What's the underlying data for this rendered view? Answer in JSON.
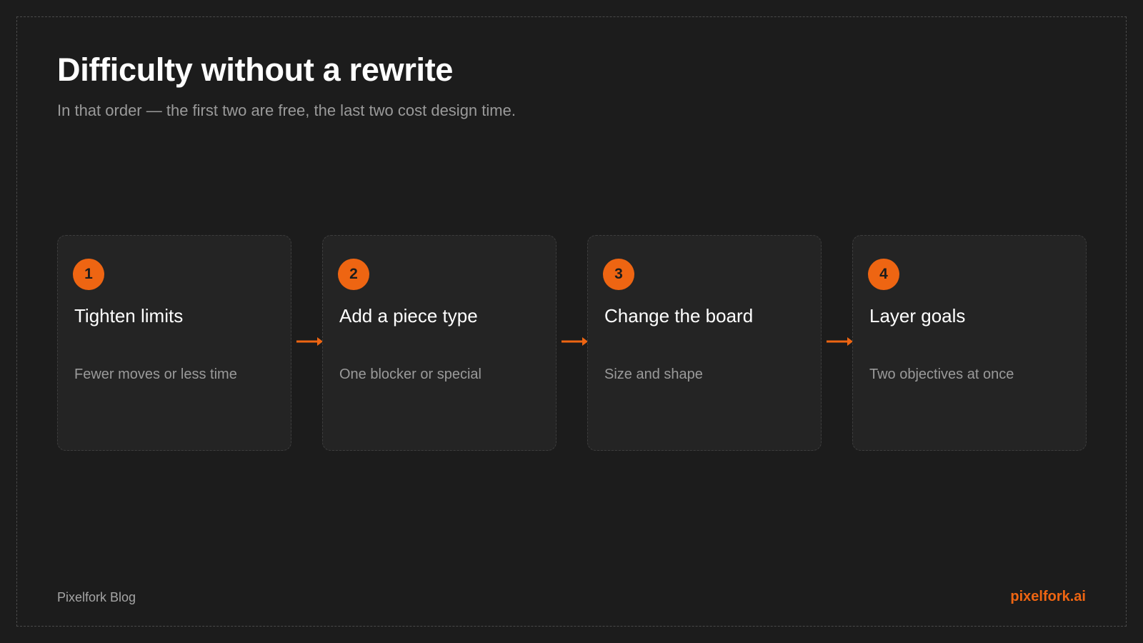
{
  "header": {
    "title": "Difficulty without a rewrite",
    "subtitle": "In that order — the first two are free, the last two cost design time."
  },
  "steps": [
    {
      "number": "1",
      "title": "Tighten limits",
      "description": "Fewer moves or less time"
    },
    {
      "number": "2",
      "title": "Add a piece type",
      "description": "One blocker or special"
    },
    {
      "number": "3",
      "title": "Change the board",
      "description": "Size and shape"
    },
    {
      "number": "4",
      "title": "Layer goals",
      "description": "Two objectives at once"
    }
  ],
  "connectors": [
    {
      "icon": "arrow-right-icon"
    },
    {
      "icon": "arrow-right-icon"
    },
    {
      "icon": "arrow-right-icon"
    }
  ],
  "footer": {
    "brand_label": "Pixelfork Blog",
    "site": "pixelfork.ai"
  },
  "colors": {
    "background": "#1c1c1c",
    "card_background": "#242424",
    "accent": "#ee6512",
    "title_text": "#ffffff",
    "muted_text": "#9a9a9a"
  }
}
